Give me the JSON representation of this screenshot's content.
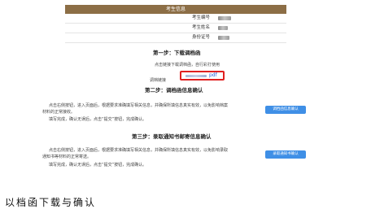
{
  "panel": {
    "title": "考生信息",
    "rows": [
      {
        "label": "考生编号"
      },
      {
        "label": "考生姓名"
      },
      {
        "label": "身份证号"
      }
    ]
  },
  "step1": {
    "title": "第一步：下载调档函",
    "instruction": "点击链接下载调档函，自行彩打使用",
    "link_label": "调档链接",
    "link_suffix": "pdf"
  },
  "step2": {
    "title": "第二步：调档函信息确认",
    "line1": "点击右侧按钮，进入页面后，根据要求准确填写相关信息，并确保所填信息真实有效，以免影响档案",
    "line2": "材料的正常接收。",
    "line3": "填写完成，确认无误后，点击“提交”按钮，完成确认。",
    "button": "调档函信息确认"
  },
  "step3": {
    "title": "第三步：录取通知书邮寄信息确认",
    "line1": "点击右侧按钮，进入页面后，根据要求准确填写相关信息，并确保所填信息真实有效，以免影响录取",
    "line2": "通知书等材料的正常寄送。",
    "line3": "填写完成，确认无误后，点击“提交”按钮，完成确认。",
    "button": "录取通知书确认"
  },
  "footer": {
    "text": "以档函下载与确认"
  }
}
